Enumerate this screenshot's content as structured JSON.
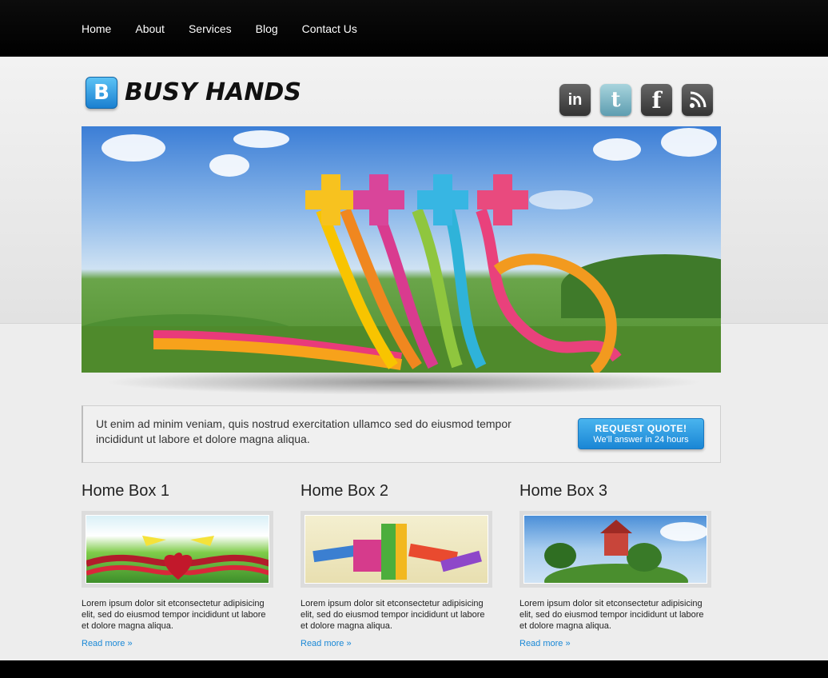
{
  "nav": {
    "items": [
      "Home",
      "About",
      "Services",
      "Blog",
      "Contact Us"
    ]
  },
  "logo": {
    "badge_letter": "B",
    "text": "BUSY HANDS"
  },
  "social": [
    {
      "name": "linkedin-icon",
      "glyph": "in"
    },
    {
      "name": "twitter-icon",
      "glyph": "t"
    },
    {
      "name": "facebook-icon",
      "glyph": "f"
    },
    {
      "name": "rss-icon",
      "glyph": "rss"
    }
  ],
  "quote": {
    "text": "Ut enim ad minim veniam, quis nostrud exercitation ullamco sed do eiusmod tempor incididunt ut labore et dolore magna aliqua.",
    "button_title": "REQUEST QUOTE!",
    "button_sub": "We'll answer in 24 hours"
  },
  "boxes": [
    {
      "title": "Home Box 1",
      "text": "Lorem ipsum dolor sit etconsectetur adipisicing elit, sed do eiusmod tempor incididunt ut labore et dolore magna aliqua.",
      "link": "Read more »"
    },
    {
      "title": "Home Box 2",
      "text": "Lorem ipsum dolor sit etconsectetur adipisicing elit, sed do eiusmod tempor incididunt ut labore et dolore magna aliqua.",
      "link": "Read more »"
    },
    {
      "title": "Home Box 3",
      "text": "Lorem ipsum dolor sit etconsectetur adipisicing elit, sed do eiusmod tempor incididunt ut labore et dolore magna aliqua.",
      "link": "Read more »"
    }
  ],
  "colors": {
    "accent": "#1a88d6",
    "topbar": "#000000",
    "button": "#2a98e0"
  }
}
